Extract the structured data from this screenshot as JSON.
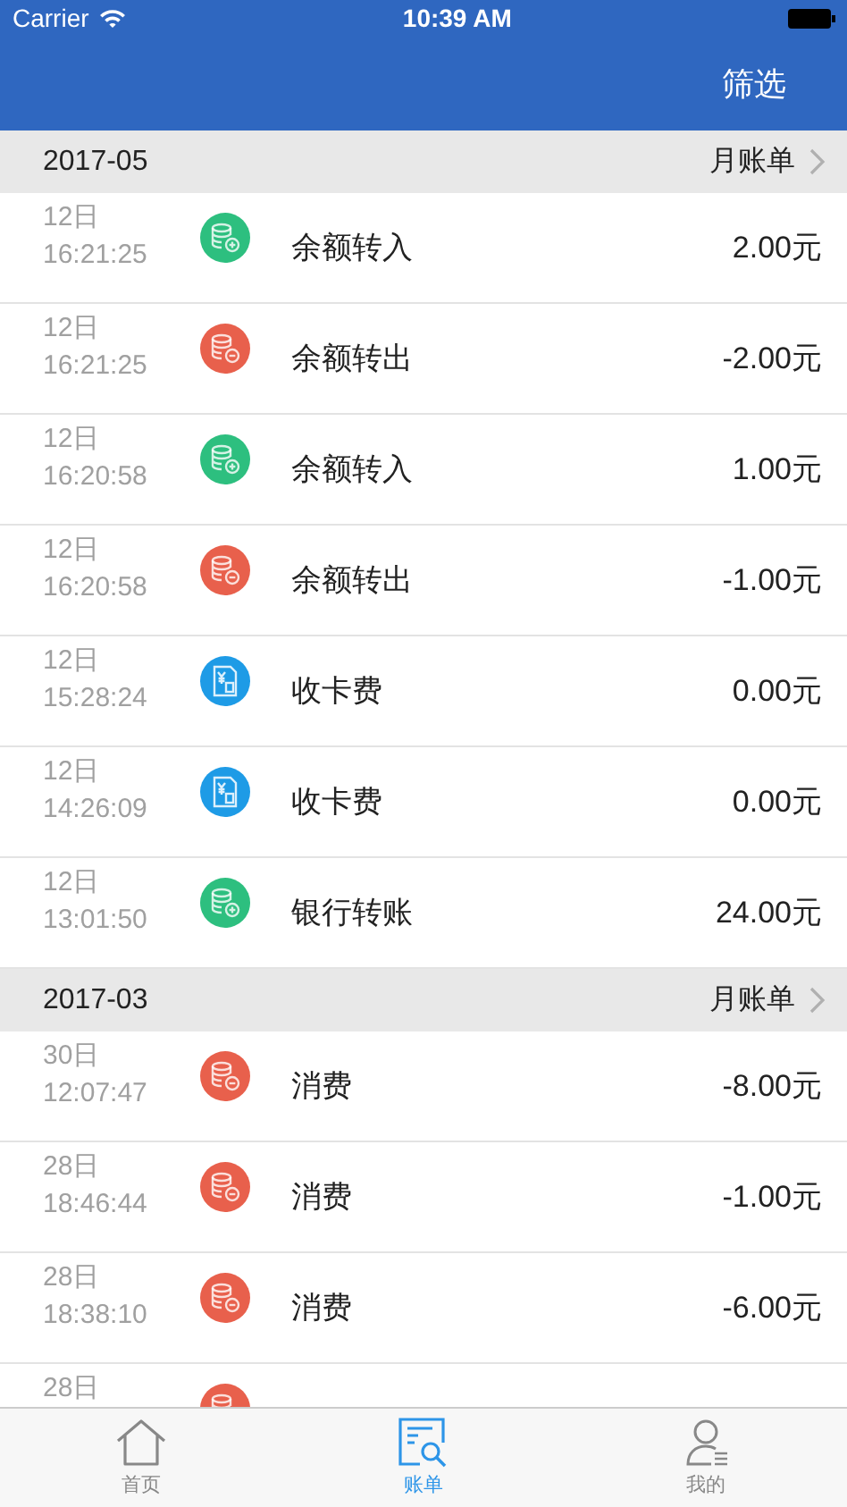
{
  "status_bar": {
    "carrier": "Carrier",
    "time": "10:39 AM"
  },
  "nav_bar": {
    "action": "筛选"
  },
  "sections": [
    {
      "month": "2017-05",
      "link": "月账单",
      "rows": [
        {
          "day": "12日",
          "time": "16:21:25",
          "kind": "in",
          "title": "余额转入",
          "amount": "2.00元"
        },
        {
          "day": "12日",
          "time": "16:21:25",
          "kind": "out",
          "title": "余额转出",
          "amount": "-2.00元"
        },
        {
          "day": "12日",
          "time": "16:20:58",
          "kind": "in",
          "title": "余额转入",
          "amount": "1.00元"
        },
        {
          "day": "12日",
          "time": "16:20:58",
          "kind": "out",
          "title": "余额转出",
          "amount": "-1.00元"
        },
        {
          "day": "12日",
          "time": "15:28:24",
          "kind": "card",
          "title": "收卡费",
          "amount": "0.00元"
        },
        {
          "day": "12日",
          "time": "14:26:09",
          "kind": "card",
          "title": "收卡费",
          "amount": "0.00元"
        },
        {
          "day": "12日",
          "time": "13:01:50",
          "kind": "in",
          "title": "银行转账",
          "amount": "24.00元"
        }
      ]
    },
    {
      "month": "2017-03",
      "link": "月账单",
      "rows": [
        {
          "day": "30日",
          "time": "12:07:47",
          "kind": "out",
          "title": "消费",
          "amount": "-8.00元"
        },
        {
          "day": "28日",
          "time": "18:46:44",
          "kind": "out",
          "title": "消费",
          "amount": "-1.00元"
        },
        {
          "day": "28日",
          "time": "18:38:10",
          "kind": "out",
          "title": "消费",
          "amount": "-6.00元"
        },
        {
          "day": "28日",
          "kind": "out"
        }
      ]
    }
  ],
  "tabs": [
    {
      "label": "首页",
      "kind": "home",
      "selected": false
    },
    {
      "label": "账单",
      "kind": "bill",
      "selected": true
    },
    {
      "label": "我的",
      "kind": "user",
      "selected": false
    }
  ]
}
